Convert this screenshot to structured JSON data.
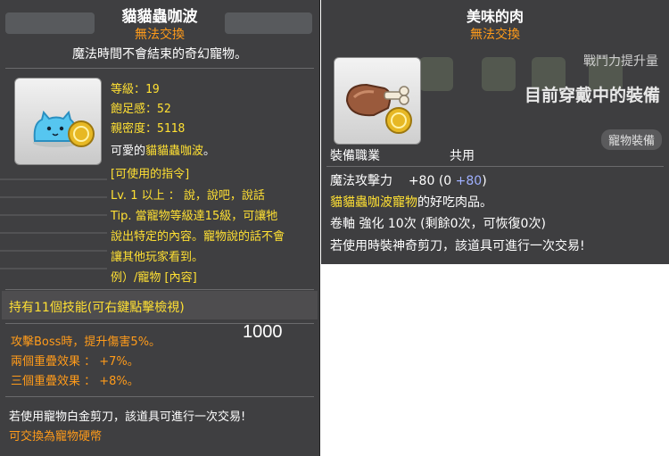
{
  "pet": {
    "title": "貓貓蟲咖波",
    "trade": "無法交換",
    "description": "魔法時間不會結束的奇幻寵物。",
    "stats": [
      "等級：19",
      "飽足感：52",
      "親密度：5118"
    ],
    "intro_prefix": "可愛的",
    "intro_name": "貓貓蟲咖波",
    "intro_suffix": "。",
    "commands_header": "[可使用的指令]",
    "commands": [
      "Lv. 1 以上 ： 說，說吧，說話",
      "Tip. 當寵物等級達15級，可讓牠",
      "說出特定的內容。寵物說的話不會",
      "讓其他玩家看到。",
      "例）/寵物 [內容]"
    ],
    "skills": "持有11個技能(可右鍵點擊檢視)",
    "bonuses": [
      "攻擊Boss時，提升傷害5%。",
      "兩個重疊效果 ： +7%。",
      "三個重疊效果 ： +8%。"
    ],
    "note": "若使用寵物白金剪刀，該道具可進行一次交易!",
    "link": "可交換為寵物硬幣",
    "counter": "1000"
  },
  "item": {
    "title": "美味的肉",
    "trade": "無法交換",
    "power_label": "戰鬥力提升量",
    "equipped_label": "目前穿戴中的裝備",
    "tag": "寵物裝備",
    "job_label": "裝備職業",
    "job_value": "共用",
    "magic_label": "魔法攻擊力",
    "magic_total": "+80",
    "magic_base": "(0 ",
    "magic_bonus": "+80",
    "magic_close": ")",
    "favorite_name": "貓貓蟲咖波寵物",
    "favorite_suffix": "的好吃肉品。",
    "scroll": "卷軸 強化 10次 (剩餘0次，可恢復0次)",
    "note": "若使用時裝神奇剪刀，該道具可進行一次交易!"
  },
  "colors": {
    "accent_orange": "#ff9b1a",
    "highlight_yellow": "#ffe033",
    "tooltip_bg": "#3f3f41"
  },
  "icons": {
    "pet": "blue-cat-bug-pet-icon",
    "meat": "meat-bone-icon",
    "coin": "gold-coin-icon"
  }
}
